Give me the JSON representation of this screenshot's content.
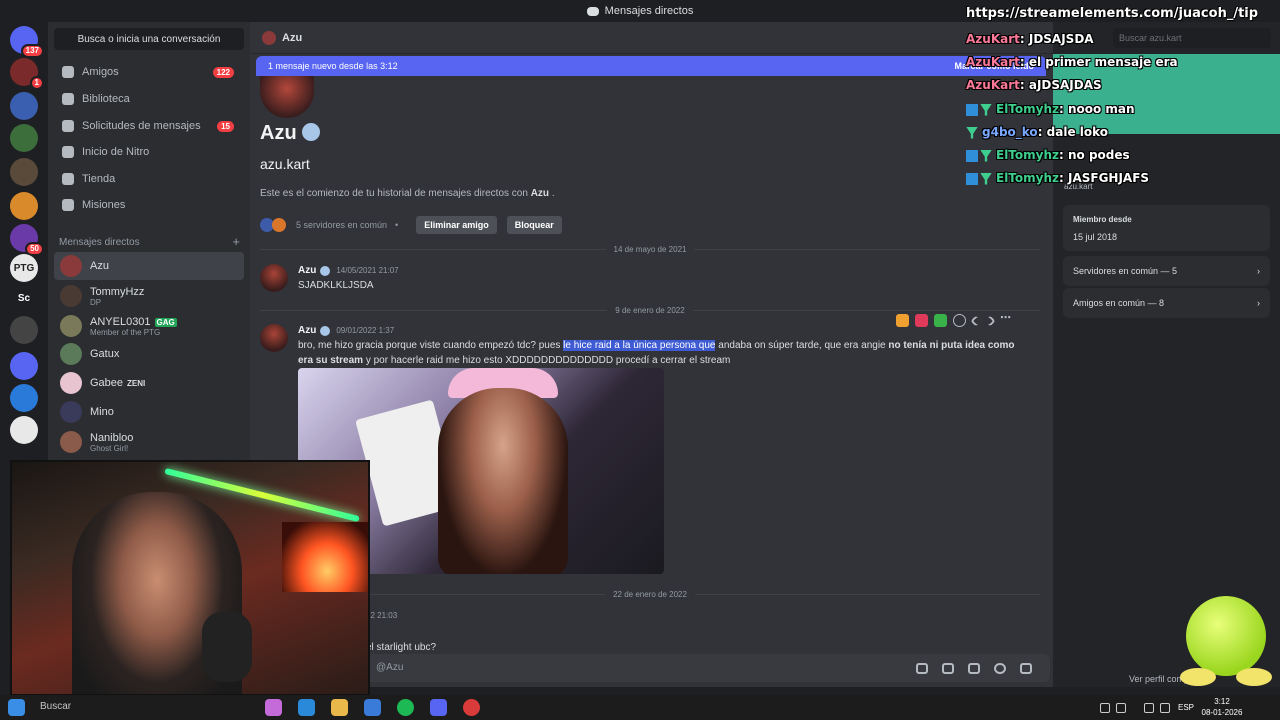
{
  "window": {
    "title": "Mensajes directos"
  },
  "rail": {
    "servers": [
      {
        "label": "",
        "color": "#5865f2",
        "badge": "137"
      },
      {
        "label": "",
        "color": "#7a2a2a",
        "badge": "1"
      },
      {
        "label": "",
        "color": "#3a5fb0",
        "badge": ""
      },
      {
        "label": "",
        "color": "#3c6e3c",
        "badge": ""
      },
      {
        "label": "",
        "color": "#5a4a3a",
        "badge": ""
      },
      {
        "label": "",
        "color": "#d98a2a",
        "badge": ""
      },
      {
        "label": "",
        "color": "#6a3aa8",
        "badge": "50"
      },
      {
        "label": "PTG",
        "color": "#e8e8e8",
        "badge": ""
      },
      {
        "label": "Sc",
        "color": "#1e1f22",
        "badge": ""
      },
      {
        "label": "",
        "color": "#444",
        "badge": ""
      },
      {
        "label": "",
        "color": "#5865f2",
        "badge": ""
      },
      {
        "label": "",
        "color": "#2a7ad9",
        "badge": ""
      },
      {
        "label": "",
        "color": "#e8e8e8",
        "badge": ""
      }
    ]
  },
  "sidebar": {
    "search_label": "Busca o inicia una conversación",
    "nav": [
      {
        "label": "Amigos",
        "count": "122"
      },
      {
        "label": "Biblioteca",
        "count": ""
      },
      {
        "label": "Solicitudes de mensajes",
        "count": "15"
      },
      {
        "label": "Inicio de Nitro",
        "count": ""
      },
      {
        "label": "Tienda",
        "count": ""
      },
      {
        "label": "Misiones",
        "count": ""
      }
    ],
    "dm_header": "Mensajes directos",
    "dm_plus": "+",
    "dms": [
      {
        "name": "Azu",
        "sub": "",
        "tag": "",
        "color": "#8a3a3a"
      },
      {
        "name": "TommyHzz",
        "sub": "DP",
        "tag": "",
        "color": "#4a3a34"
      },
      {
        "name": "ANYEL0301",
        "sub": "Member of the PTG",
        "tag": "GAG",
        "color": "#7a7a5a"
      },
      {
        "name": "Gatux",
        "sub": "",
        "tag": "",
        "color": "#5a7a5a"
      },
      {
        "name": "Gabee",
        "sub": "",
        "tag": "ZENI",
        "color": "#e8c4d0"
      },
      {
        "name": "Mino",
        "sub": "",
        "tag": "",
        "color": "#3a3a5a"
      },
      {
        "name": "Nanibloo",
        "sub": "Ghost Girl!",
        "tag": "",
        "color": "#8a5a4a"
      }
    ]
  },
  "chat": {
    "header_name": "Azu",
    "new_banner": "1 mensaje nuevo desde las 3:12",
    "mark_read": "Marcar como leído",
    "profile_name": "Azu",
    "profile_user": "azu.kart",
    "intro_pre": "Este es el comienzo de tu historial de mensajes directos con",
    "intro_name": "Azu",
    "intro_post": ".",
    "common_servers": "5 servidores en común",
    "remove_friend": "Eliminar amigo",
    "block": "Bloquear",
    "dividers": [
      "14 de mayo de 2021",
      "9 de enero de 2022",
      "22 de enero de 2022"
    ],
    "messages": [
      {
        "author": "Azu",
        "time": "14/05/2021 21:07",
        "text": "SJADKLKLJSDA"
      },
      {
        "author": "Azu",
        "time": "09/01/2022 1:37",
        "p1": "bro, me hizo gracia porque viste cuando empezó tdc? pues ",
        "p2": "le hice raid a la única persona que",
        "p3": " andaba on súper tarde, que era angie ",
        "p4": "no tenía ni puta idea como era su stream",
        "p5": " y por hacerle raid me hizo esto XDDDDDDDDDDDDDD procedí a cerrar el stream"
      }
    ],
    "partial_time": "22 21:03",
    "partial_text": "el starlight ubc?",
    "input_placeholder": "@Azu"
  },
  "profile_panel": {
    "search_placeholder": "Buscar azu.kart",
    "username": "azu.kart",
    "member_since_label": "Miembro desde",
    "member_since": "15 jul 2018",
    "common_servers": "Servidores en común — 5",
    "common_friends": "Amigos en común — 8",
    "view_profile": "Ver perfil completo"
  },
  "overlay": {
    "link": "https://streamelements.com/juacoh_/tip",
    "chat": [
      {
        "user": "AzuKart",
        "color": "#ff7a9a",
        "msg": ": JDSAJSDA",
        "badges": false
      },
      {
        "user": "AzuKart",
        "color": "#ff7a9a",
        "msg": ": el primer mensaje era",
        "badges": false
      },
      {
        "user": "AzuKart",
        "color": "#ff7a9a",
        "msg": ": aJDSAJDAS",
        "badges": false
      },
      {
        "user": "ElTomyhz",
        "color": "#3ecf8e",
        "msg": ": nooo man",
        "badges": true
      },
      {
        "user": "g4bo_ko",
        "color": "#7aa8ff",
        "msg": ": dale loko",
        "badges": true
      },
      {
        "user": "ElTomyhz",
        "color": "#3ecf8e",
        "msg": ": no podes",
        "badges": true
      },
      {
        "user": "ElTomyhz",
        "color": "#3ecf8e",
        "msg": ": JASFGHJAFS",
        "badges": true
      }
    ]
  },
  "taskbar": {
    "search": "Buscar",
    "lang": "ESP",
    "time": "3:12",
    "date": "08-01-2026"
  },
  "colors": {
    "accent": "#5865f2",
    "highlight": "#3e5bd3",
    "danger": "#f23f43"
  }
}
